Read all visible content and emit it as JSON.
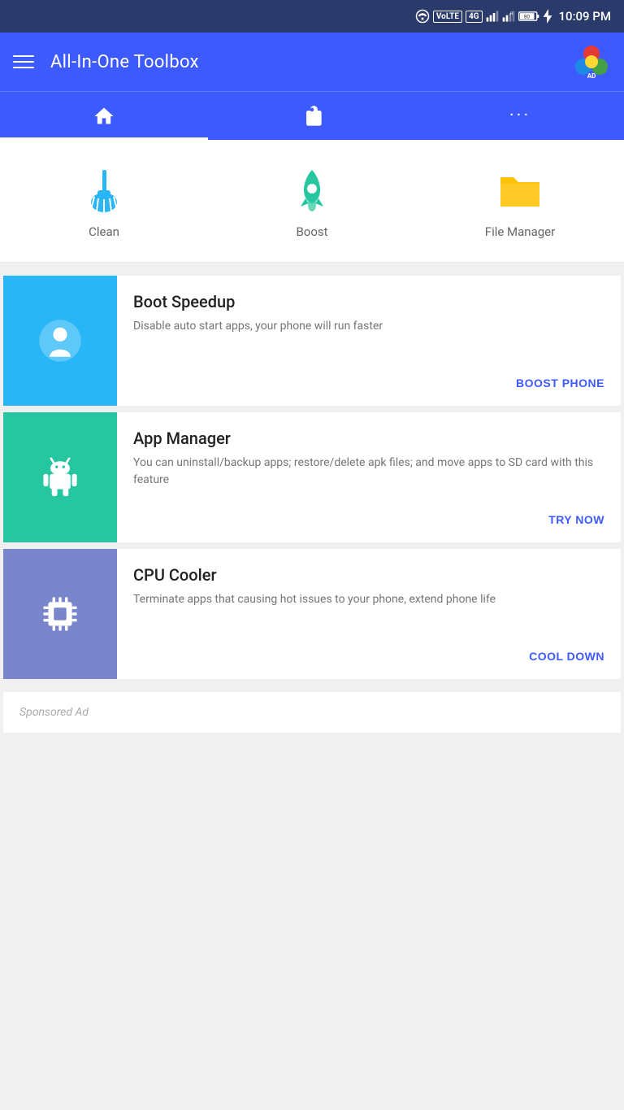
{
  "statusBar": {
    "time": "10:09 PM",
    "icons": [
      "wifi",
      "volte",
      "4g",
      "signal",
      "signal-r",
      "battery-80",
      "charging"
    ]
  },
  "toolbar": {
    "menuLabel": "Menu",
    "title": "All-In-One Toolbox",
    "adLabel": "AD"
  },
  "navTabs": [
    {
      "id": "home",
      "label": "Home",
      "active": true
    },
    {
      "id": "briefcase",
      "label": "Briefcase",
      "active": false
    },
    {
      "id": "more",
      "label": "More",
      "active": false
    }
  ],
  "quickActions": [
    {
      "id": "clean",
      "label": "Clean",
      "iconColor": "#29b6f6"
    },
    {
      "id": "boost",
      "label": "Boost",
      "iconColor": "#26c6a0"
    },
    {
      "id": "file-manager",
      "label": "File Manager",
      "iconColor": "#ffc107"
    }
  ],
  "featureCards": [
    {
      "id": "boot-speedup",
      "title": "Boot Speedup",
      "description": "Disable auto start apps, your phone will run faster",
      "actionLabel": "BOOST PHONE",
      "bgColor": "#29b6f6",
      "icon": "rocket"
    },
    {
      "id": "app-manager",
      "title": "App Manager",
      "description": "You can uninstall/backup apps; restore/delete apk files; and move apps to SD card with this feature",
      "actionLabel": "TRY NOW",
      "bgColor": "#26c6a0",
      "icon": "android"
    },
    {
      "id": "cpu-cooler",
      "title": "CPU Cooler",
      "description": "Terminate apps that causing hot issues to your phone, extend phone life",
      "actionLabel": "COOL DOWN",
      "bgColor": "#7986cb",
      "icon": "cpu"
    }
  ],
  "sponsoredAd": {
    "label": "Sponsored Ad"
  }
}
